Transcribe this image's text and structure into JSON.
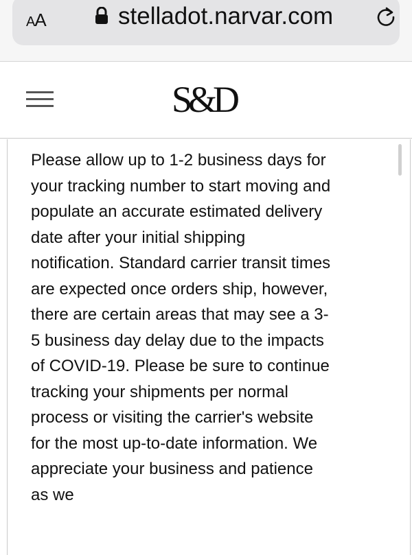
{
  "browser": {
    "text_size_label_big": "A",
    "text_size_label_small": "A",
    "url": "stelladot.narvar.com",
    "icons": [
      "lock-icon",
      "reload-icon"
    ]
  },
  "header": {
    "logo_text": "S&D",
    "icons": [
      "menu-icon"
    ]
  },
  "main": {
    "notice": "Please allow up to 1-2 business days for your tracking number to start moving and populate an accurate estimated delivery date after your initial shipping notification. Standard carrier transit times are expected once orders ship, however, there are certain areas that may see a 3-5 business day delay due to the impacts of COVID-19. Please be sure to continue tracking your shipments per normal process or visiting the carrier's website for the most up-to-date information. We appreciate your business and patience as we"
  }
}
